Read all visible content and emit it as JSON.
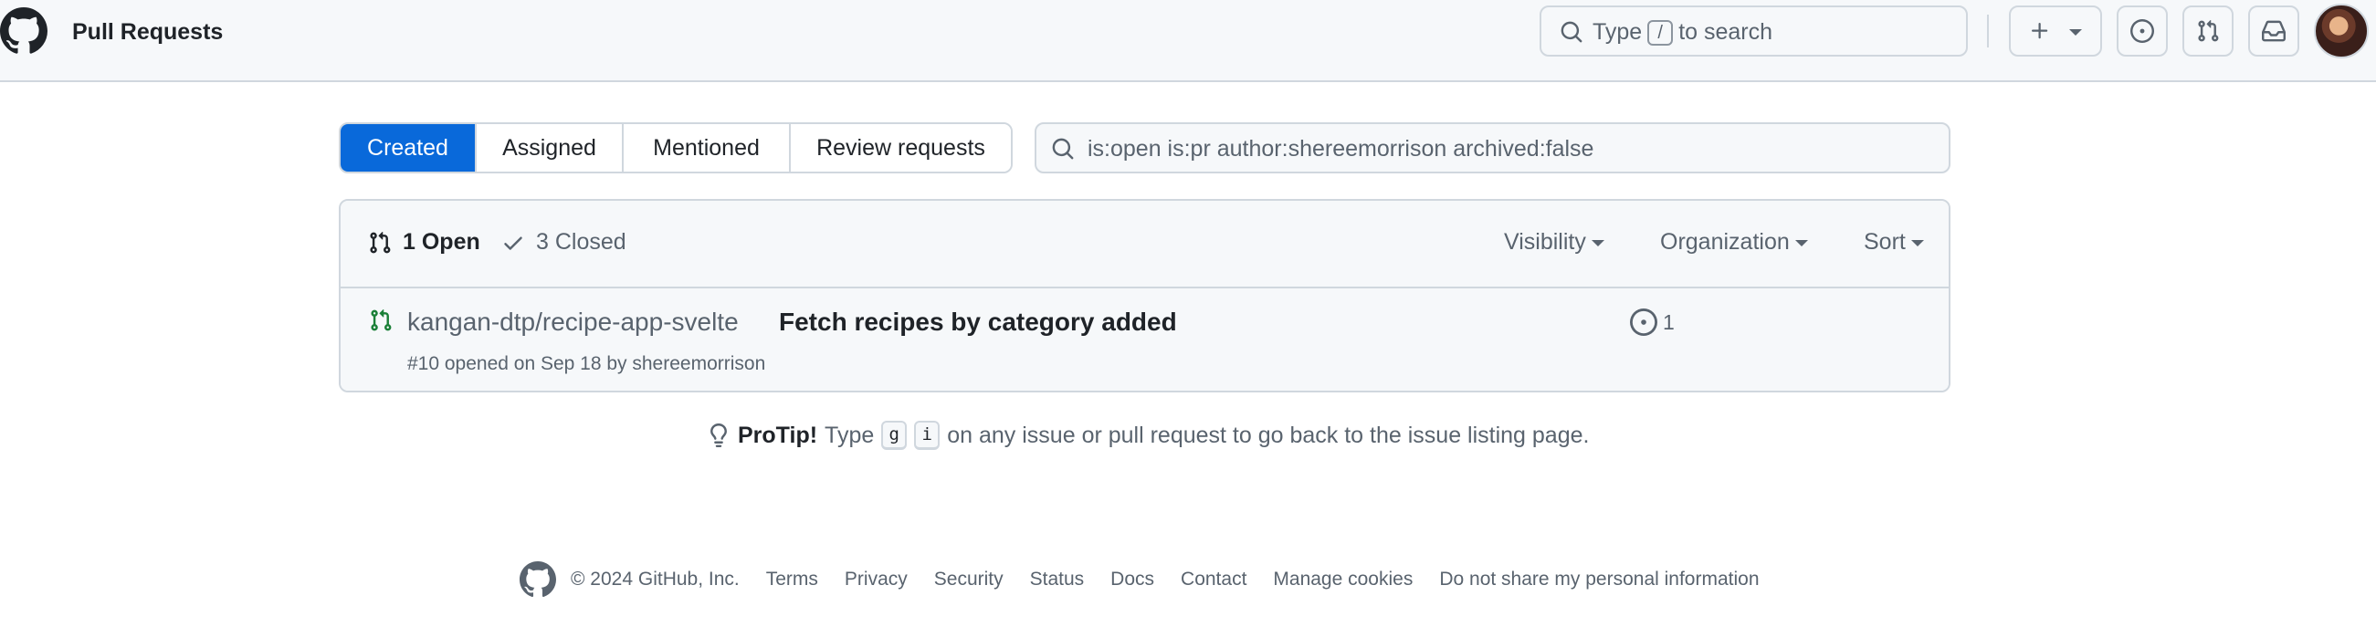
{
  "header": {
    "title": "Pull Requests",
    "search_prefix": "Type",
    "search_key": "/",
    "search_suffix": "to search",
    "create_icon": "plus-icon",
    "issues_icon": "issue-opened-icon",
    "prs_icon": "git-pull-request-icon",
    "inbox_icon": "inbox-icon"
  },
  "subnav": {
    "items": [
      {
        "label": "Created",
        "selected": true
      },
      {
        "label": "Assigned",
        "selected": false
      },
      {
        "label": "Mentioned",
        "selected": false
      },
      {
        "label": "Review requests",
        "selected": false
      }
    ]
  },
  "filter": {
    "value": "is:open is:pr author:shereemorrison archived:false"
  },
  "list": {
    "open_label": "1 Open",
    "closed_label": "3 Closed",
    "menus": {
      "visibility": "Visibility",
      "organization": "Organization",
      "sort": "Sort"
    },
    "rows": [
      {
        "repo": "kangan-dtp/recipe-app-svelte",
        "title": "Fetch recipes by category added",
        "meta": "#10 opened on Sep 18 by shereemorrison",
        "linked_issues": "1"
      }
    ]
  },
  "protip": {
    "label": "ProTip!",
    "before": "Type",
    "key1": "g",
    "key2": "i",
    "after": "on any issue or pull request to go back to the issue listing page."
  },
  "footer": {
    "copyright": "© 2024 GitHub, Inc.",
    "links": [
      "Terms",
      "Privacy",
      "Security",
      "Status",
      "Docs",
      "Contact",
      "Manage cookies",
      "Do not share my personal information"
    ]
  },
  "colors": {
    "accent": "#0969da",
    "open_green": "#1a7f37",
    "muted": "#59636e",
    "border": "#d0d7de",
    "canvas_subtle": "#f6f8fa"
  }
}
